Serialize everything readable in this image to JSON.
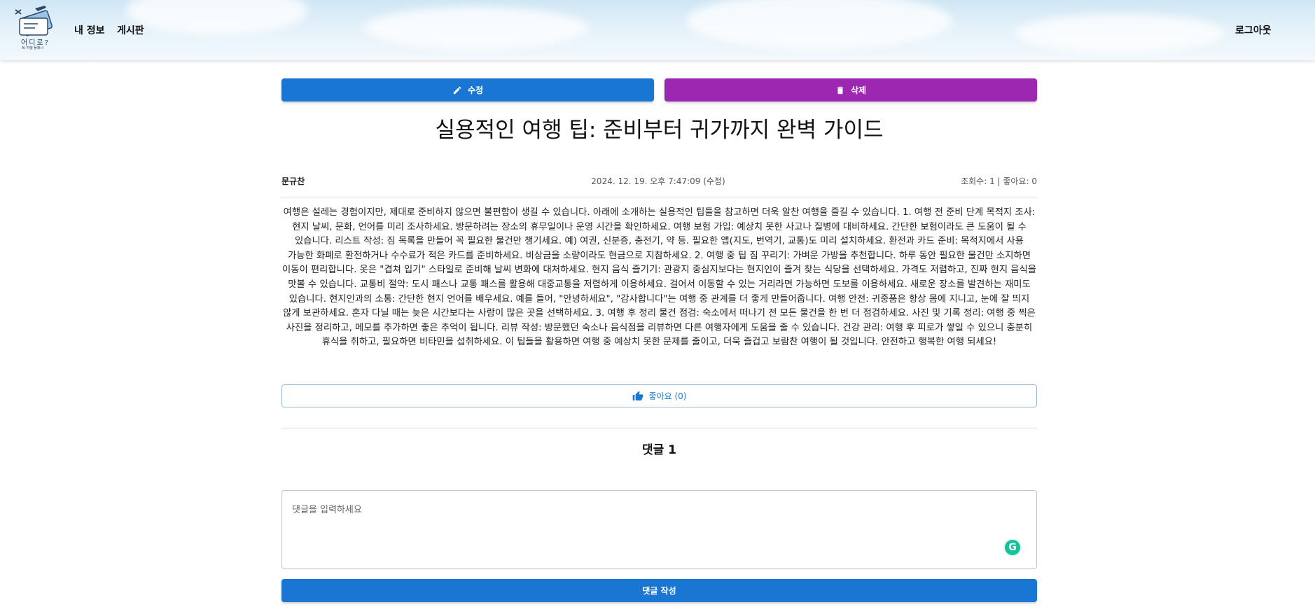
{
  "header": {
    "logo_text": "어디로?",
    "logo_sub": "AI 여행 플래너",
    "nav": [
      "내 정보",
      "게시판"
    ],
    "logout_label": "로그아웃"
  },
  "actions": {
    "edit_label": "수정",
    "delete_label": "삭제"
  },
  "post": {
    "title": "실용적인 여행 팁: 준비부터 귀가까지 완벽 가이드",
    "author": "문규찬",
    "datetime": "2024. 12. 19. 오후 7:47:09 (수정)",
    "stats": "조회수: 1 | 좋아요: 0",
    "content": "여행은 설레는 경험이지만, 제대로 준비하지 않으면 불편함이 생길 수 있습니다. 아래에 소개하는 실용적인 팁들을 참고하면 더욱 알찬 여행을 즐길 수 있습니다. 1. 여행 전 준비 단계 목적지 조사: 현지 날씨, 문화, 언어를 미리 조사하세요. 방문하려는 장소의 휴무일이나 운영 시간을 확인하세요. 여행 보험 가입: 예상치 못한 사고나 질병에 대비하세요. 간단한 보험이라도 큰 도움이 될 수 있습니다. 리스트 작성: 짐 목록을 만들어 꼭 필요한 물건만 챙기세요. 예) 여권, 신분증, 충전기, 약 등. 필요한 앱(지도, 번역기, 교통)도 미리 설치하세요. 환전과 카드 준비: 목적지에서 사용 가능한 화폐로 환전하거나 수수료가 적은 카드를 준비하세요. 비상금을 소량이라도 현금으로 지참하세요. 2. 여행 중 팁 짐 꾸리기: 가벼운 가방을 추천합니다. 하루 동안 필요한 물건만 소지하면 이동이 편리합니다. 옷은 \"겹쳐 입기\" 스타일로 준비해 날씨 변화에 대처하세요. 현지 음식 즐기기: 관광지 중심지보다는 현지인이 즐겨 찾는 식당을 선택하세요. 가격도 저렴하고, 진짜 현지 음식을 맛볼 수 있습니다. 교통비 절약: 도시 패스나 교통 패스를 활용해 대중교통을 저렴하게 이용하세요. 걸어서 이동할 수 있는 거리라면 가능하면 도보를 이용하세요. 새로운 장소를 발견하는 재미도 있습니다. 현지인과의 소통: 간단한 현지 언어를 배우세요. 예를 들어, \"안녕하세요\", \"감사합니다\"는 여행 중 관계를 더 좋게 만들어줍니다. 여행 안전: 귀중품은 항상 몸에 지니고, 눈에 잘 띄지 않게 보관하세요. 혼자 다닐 때는 늦은 시간보다는 사람이 많은 곳을 선택하세요. 3. 여행 후 정리 물건 점검: 숙소에서 떠나기 전 모든 물건을 한 번 더 점검하세요. 사진 및 기록 정리: 여행 중 찍은 사진을 정리하고, 메모를 추가하면 좋은 추억이 됩니다. 리뷰 작성: 방문했던 숙소나 음식점을 리뷰하면 다른 여행자에게 도움을 줄 수 있습니다. 건강 관리: 여행 후 피로가 쌓일 수 있으니 충분히 휴식을 취하고, 필요하면 비타민을 섭취하세요. 이 팁들을 활용하면 여행 중 예상치 못한 문제를 줄이고, 더욱 즐겁고 보람찬 여행이 될 것입니다. 안전하고 행복한 여행 되세요!"
  },
  "like": {
    "label": "좋아요 (0)"
  },
  "comments": {
    "title": "댓글 1",
    "input_placeholder": "댓글을 입력하세요",
    "input_value": "",
    "submit_label": "댓글 작성"
  },
  "colors": {
    "edit": "#1976d2",
    "delete": "#9c27b0",
    "submit": "#1976d2",
    "like_text": "#1976d2",
    "grammarly": "#15c39a"
  }
}
